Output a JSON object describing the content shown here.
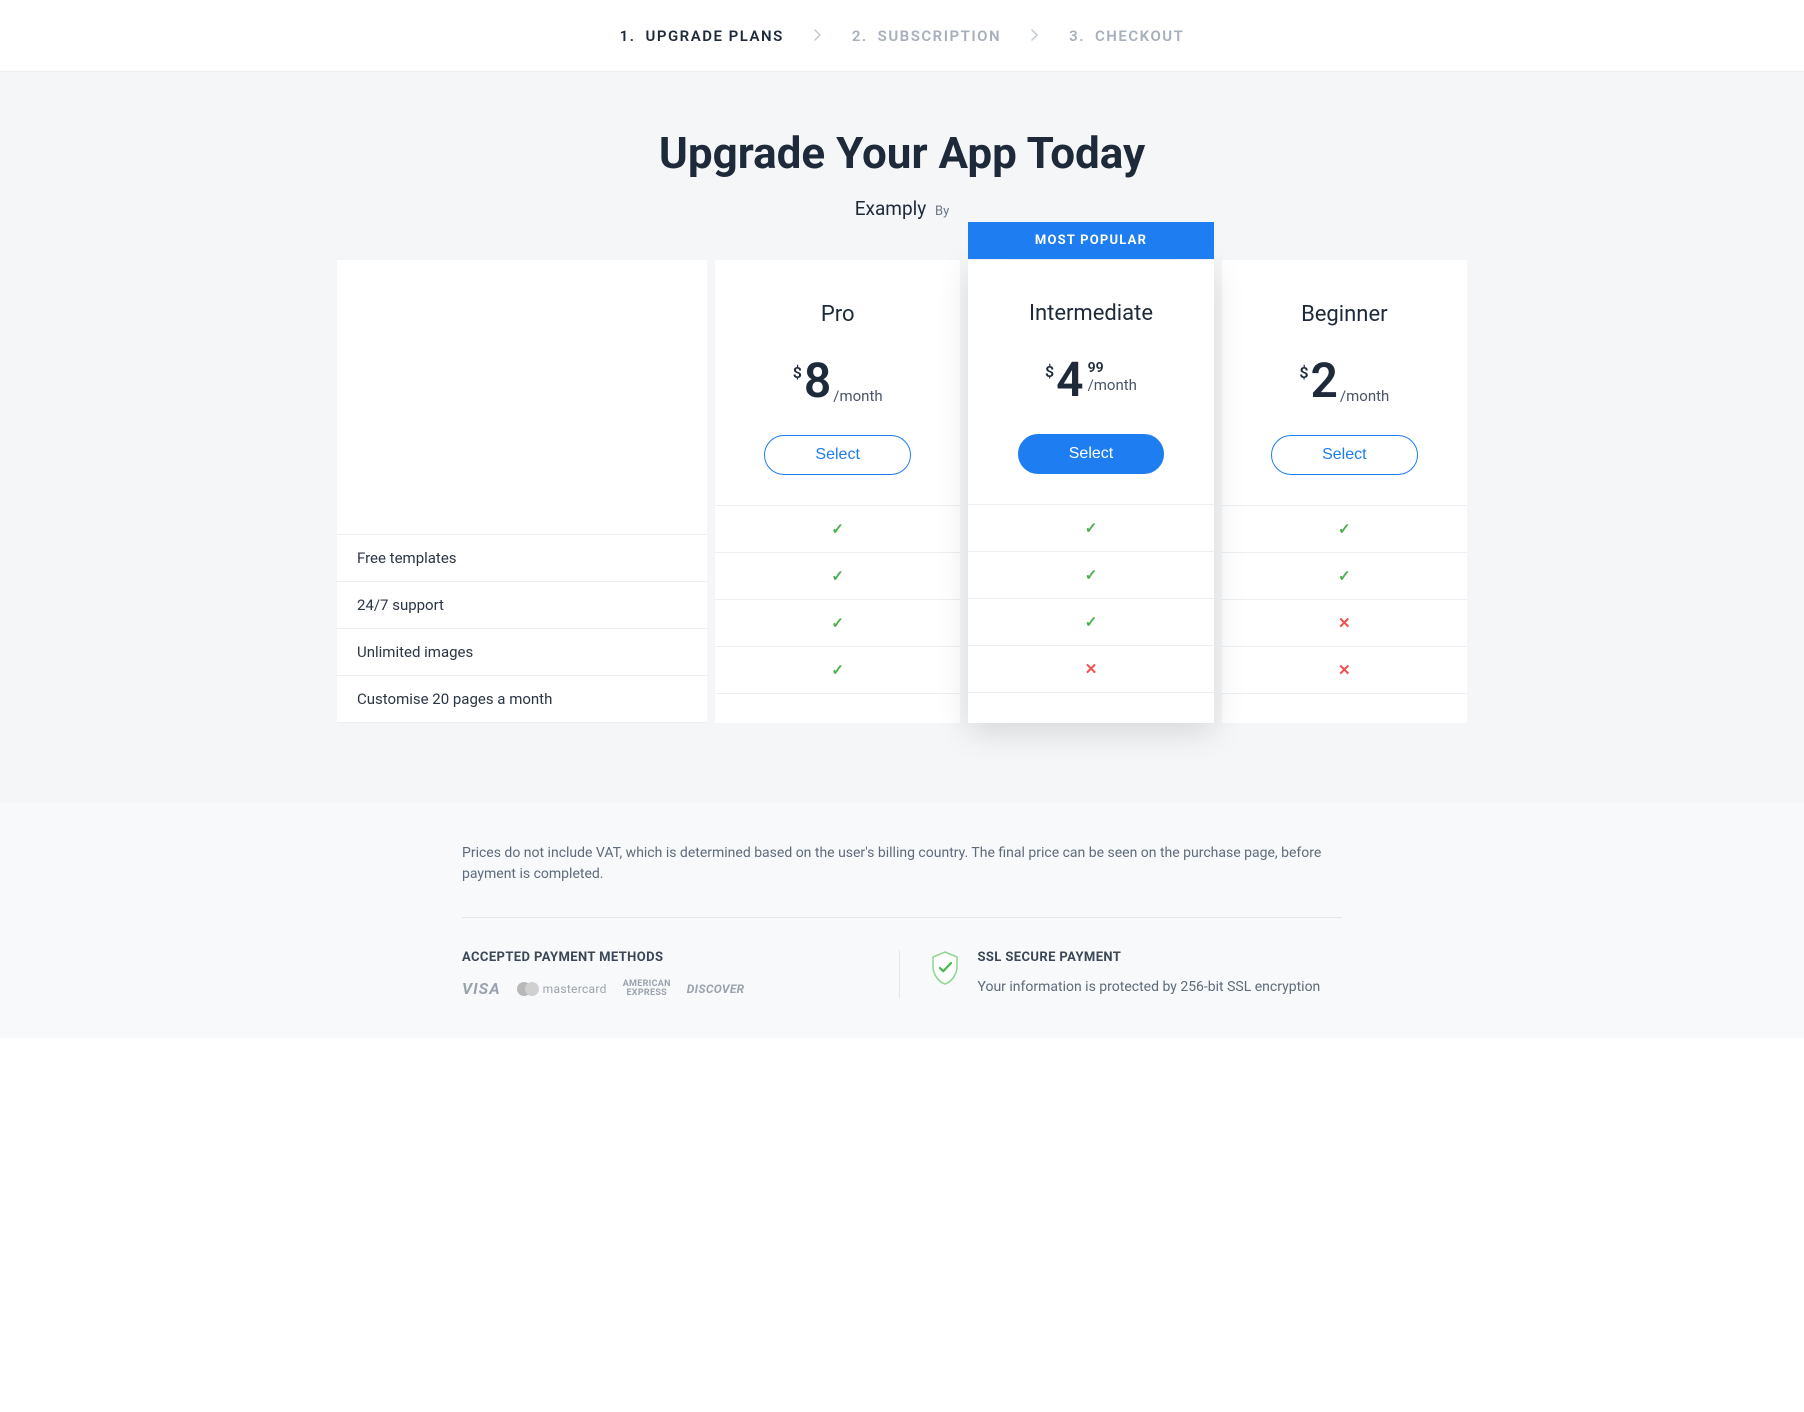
{
  "stepper": {
    "steps": [
      {
        "num": "1.",
        "label": "UPGRADE PLANS",
        "active": true
      },
      {
        "num": "2.",
        "label": "SUBSCRIPTION",
        "active": false
      },
      {
        "num": "3.",
        "label": "CHECKOUT",
        "active": false
      }
    ]
  },
  "header": {
    "title": "Upgrade Your App Today",
    "app_name": "Examply",
    "by_label": "By"
  },
  "badge": {
    "most_popular": "MOST POPULAR"
  },
  "plans": [
    {
      "id": "pro",
      "name": "Pro",
      "currency": "$",
      "amount": "8",
      "cents": "",
      "period": "/month",
      "select_label": "Select",
      "popular": false,
      "features": {
        "free_templates": true,
        "support_247": true,
        "unlimited_images": true,
        "customise_pages": true
      }
    },
    {
      "id": "intermediate",
      "name": "Intermediate",
      "currency": "$",
      "amount": "4",
      "cents": "99",
      "period": "/month",
      "select_label": "Select",
      "popular": true,
      "features": {
        "free_templates": true,
        "support_247": true,
        "unlimited_images": true,
        "customise_pages": false
      }
    },
    {
      "id": "beginner",
      "name": "Beginner",
      "currency": "$",
      "amount": "2",
      "cents": "",
      "period": "/month",
      "select_label": "Select",
      "popular": false,
      "features": {
        "free_templates": true,
        "support_247": true,
        "unlimited_images": false,
        "customise_pages": false
      }
    }
  ],
  "feature_labels": {
    "free_templates": "Free templates",
    "support_247": "24/7 support",
    "unlimited_images": "Unlimited images",
    "customise_pages": "Customise 20 pages a month"
  },
  "footer": {
    "disclaimer": "Prices do not include VAT, which is determined based on the user's billing country. The final price can be seen on the purchase page, before payment is completed.",
    "accepted_heading": "ACCEPTED PAYMENT METHODS",
    "payment_methods": {
      "visa": "VISA",
      "mastercard": "mastercard",
      "amex_line1": "AMERICAN",
      "amex_line2": "EXPRESS",
      "discover": "DISCOVER"
    },
    "ssl_heading": "SSL SECURE PAYMENT",
    "ssl_text": "Your information is protected by 256-bit SSL encryption"
  }
}
